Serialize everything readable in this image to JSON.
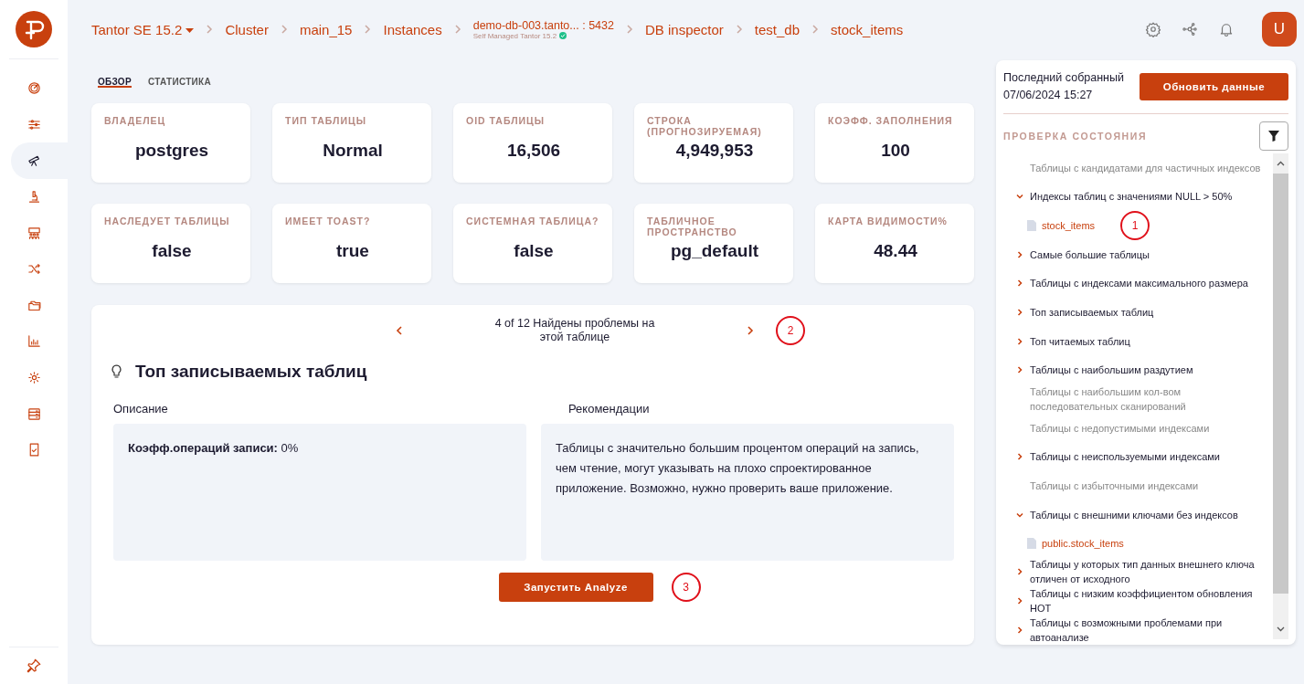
{
  "breadcrumb": [
    {
      "kind": "dropdown",
      "label": "Tantor SE 15.2"
    },
    {
      "kind": "link",
      "label": "Cluster"
    },
    {
      "kind": "link",
      "label": "main_15"
    },
    {
      "kind": "link",
      "label": "Instances"
    },
    {
      "kind": "instance",
      "label": "demo-db-003.tanto... : 5432",
      "subtitle": "Self Managed Tantor 15.2",
      "verified": true
    },
    {
      "kind": "link",
      "label": "DB inspector"
    },
    {
      "kind": "link",
      "label": "test_db"
    },
    {
      "kind": "link",
      "label": "stock_items"
    }
  ],
  "avatar": "U",
  "sidebar": {
    "items": [
      {
        "selected": false
      },
      {
        "selected": false
      },
      {
        "selected": true
      },
      {
        "selected": false
      },
      {
        "selected": false
      },
      {
        "selected": false
      },
      {
        "selected": false
      },
      {
        "selected": false
      },
      {
        "selected": false
      },
      {
        "selected": false
      },
      {
        "selected": false
      }
    ]
  },
  "tabs": [
    {
      "label": "ОБЗОР",
      "selected": true
    },
    {
      "label": "СТАТИСТИКА",
      "selected": false
    }
  ],
  "stats": [
    {
      "label": "ВЛАДЕЛЕЦ",
      "value": "postgres"
    },
    {
      "label": "ТИП ТАБЛИЦЫ",
      "value": "Normal"
    },
    {
      "label": "OID ТАБЛИЦЫ",
      "value": "16,506"
    },
    {
      "label": "СТРОКА (ПРОГНОЗИРУЕМАЯ)",
      "value": "4,949,953"
    },
    {
      "label": "КОЭФФ. ЗАПОЛНЕНИЯ",
      "value": "100"
    },
    {
      "label": "НАСЛЕДУЕТ ТАБЛИЦЫ",
      "value": "false"
    },
    {
      "label": "ИМЕЕТ TOAST?",
      "value": "true"
    },
    {
      "label": "СИСТЕМНАЯ ТАБЛИЦА?",
      "value": "false"
    },
    {
      "label": "ТАБЛИЧНОЕ ПРОСТРАНСТВО",
      "value": "pg_default"
    },
    {
      "label": "КАРТА ВИДИМОСТИ%",
      "value": "48.44"
    }
  ],
  "issue": {
    "pager": "4 of 12 Найдены проблемы на этой таблице",
    "pager_callout": "2",
    "title": "Топ записываемых таблиц",
    "description_label": "Описание",
    "description": "**Коэфф.операций записи:** 0%",
    "recommendations_label": "Рекомендации",
    "recommendations": "Таблицы с значительно большим процентом операций на запись, чем чтение, могут указывать на плохо спроектированное приложение. Возможно, нужно проверить ваше приложение.",
    "button": "Запустить Analyze",
    "button_callout": "3"
  },
  "health": {
    "last_collected_label": "Последний собранный",
    "last_collected": "07/06/2024 15:27",
    "refresh_button": "Обновить данные",
    "title": "ПРОВЕРКА СОСТОЯНИЯ",
    "items": [
      {
        "label": "Таблицы с кандидатами для частичных индексов",
        "kind": "empty"
      },
      {
        "label": "Индексы таблиц с значениями NULL > 50%",
        "kind": "group",
        "expanded": true,
        "children": [
          {
            "label": "stock_items",
            "callout": "1"
          }
        ]
      },
      {
        "label": "Самые большие таблицы",
        "kind": "group",
        "expanded": false
      },
      {
        "label": "Таблицы с индексами максимального размера",
        "kind": "group",
        "expanded": false
      },
      {
        "label": "Топ записываемых таблиц",
        "kind": "group",
        "expanded": false
      },
      {
        "label": "Топ читаемых таблиц",
        "kind": "group",
        "expanded": false
      },
      {
        "label": "Таблицы с наибольшим раздутием",
        "kind": "group",
        "expanded": false
      },
      {
        "label": "Таблицы с наибольшим кол-вом последовательных сканирований",
        "kind": "empty"
      },
      {
        "label": "Таблицы с недопустимыми индексами",
        "kind": "empty"
      },
      {
        "label": "Таблицы с неиспользуемыми индексами",
        "kind": "group",
        "expanded": false
      },
      {
        "label": "Таблицы с избыточными индексами",
        "kind": "empty"
      },
      {
        "label": "Таблицы с внешними ключами без индексов",
        "kind": "group",
        "expanded": true,
        "children": [
          {
            "label": "public.stock_items"
          }
        ]
      },
      {
        "label": "Таблицы у которых тип данных внешнего ключа отличен от исходного",
        "kind": "group",
        "expanded": false
      },
      {
        "label": "Таблицы с низким коэффициентом обновления HOT",
        "kind": "group",
        "expanded": false
      },
      {
        "label": "Таблицы с возможными проблемами при автоанализе",
        "kind": "group",
        "expanded": false
      }
    ]
  }
}
